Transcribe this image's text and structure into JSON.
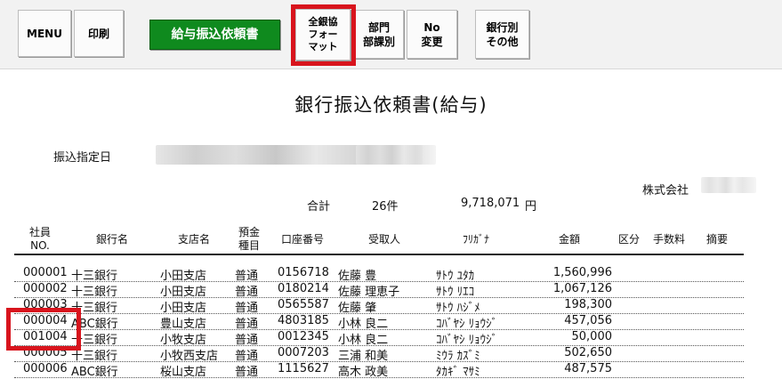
{
  "toolbar": {
    "menu": "MENU",
    "print": "印刷",
    "title_button": "給与振込依頼書",
    "zengin": "全銀協\nフォー\nマット",
    "dept": "部門\n部課別",
    "no_change": "No\n変更",
    "by_bank": "銀行別\nその他"
  },
  "document": {
    "title": "銀行振込依頼書(給与)",
    "date_label": "振込指定日",
    "company": "株式会社",
    "total_label": "合計",
    "count": "26件",
    "amount": "9,718,071",
    "yen": "円"
  },
  "columns": {
    "emp_no": "社員\nNO.",
    "bank": "銀行名",
    "branch": "支店名",
    "deposit": "預金\n種目",
    "account": "口座番号",
    "payee": "受取人",
    "kana": "ﾌﾘｶﾞﾅ",
    "amount": "金額",
    "category": "区分",
    "fee": "手数料",
    "note": "摘要"
  },
  "rows": [
    {
      "no": "000001",
      "bank": "十三銀行",
      "branch": "小田支店",
      "type": "普通",
      "account": "0156718",
      "name": "佐藤 豊",
      "kana": "ｻﾄｳ ﾕﾀｶ",
      "amount": "1,560,996"
    },
    {
      "no": "000002",
      "bank": "十三銀行",
      "branch": "小田支店",
      "type": "普通",
      "account": "0180214",
      "name": "佐藤 理恵子",
      "kana": "ｻﾄｳ ﾘｴｺ",
      "amount": "1,067,126"
    },
    {
      "no": "000003",
      "bank": "十三銀行",
      "branch": "小田支店",
      "type": "普通",
      "account": "0565587",
      "name": "佐藤 肇",
      "kana": "ｻﾄｳ ﾊｼﾞﾒ",
      "amount": "198,300"
    },
    {
      "no": "000004",
      "bank": "ABC銀行",
      "branch": "豊山支店",
      "type": "普通",
      "account": "4803185",
      "name": "小林 良二",
      "kana": "ｺﾊﾞﾔｼ ﾘｮｳｼﾞ",
      "amount": "457,056"
    },
    {
      "no": "001004",
      "bank": "十三銀行",
      "branch": "小牧支店",
      "type": "普通",
      "account": "0012345",
      "name": "小林 良二",
      "kana": "ｺﾊﾞﾔｼ ﾘｮｳｼﾞ",
      "amount": "50,000"
    },
    {
      "no": "000005",
      "bank": "十三銀行",
      "branch": "小牧西支店",
      "type": "普通",
      "account": "0007203",
      "name": "三浦 和美",
      "kana": "ﾐｳﾗ ｶｽﾞﾐ",
      "amount": "502,650"
    },
    {
      "no": "000006",
      "bank": "ABC銀行",
      "branch": "桜山支店",
      "type": "普通",
      "account": "1115627",
      "name": "高木 政美",
      "kana": "ﾀｶｷﾞ ﾏｻﾐ",
      "amount": "487,575"
    }
  ]
}
